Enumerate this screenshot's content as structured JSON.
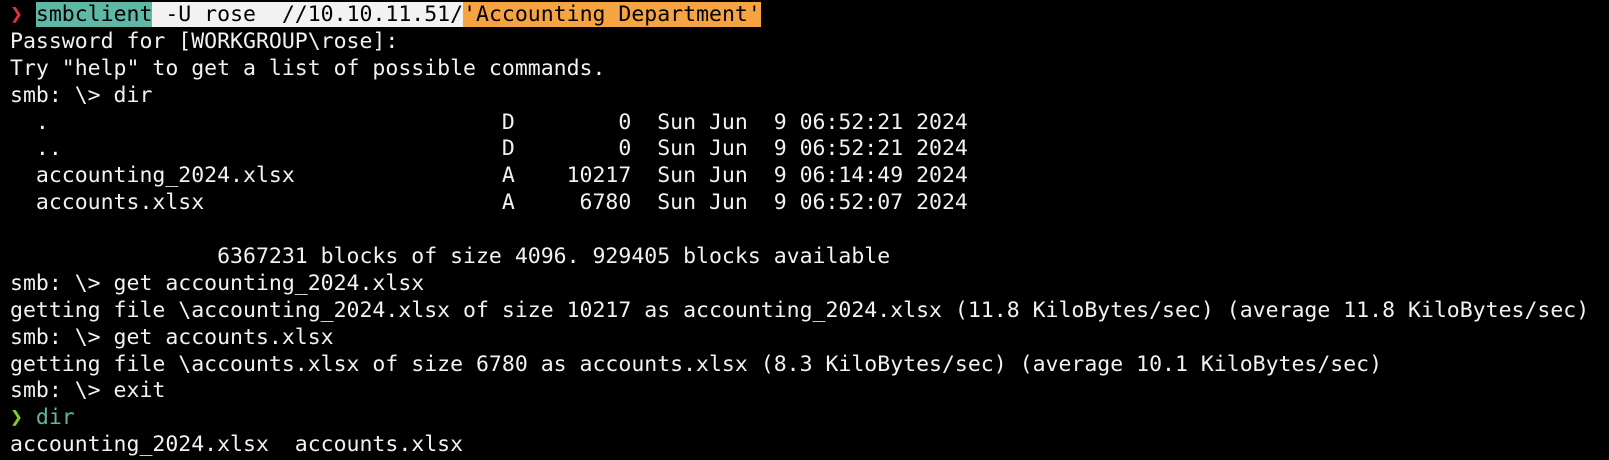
{
  "colors": {
    "background": "#000000",
    "foreground": "#f2f2f2",
    "prompt_error": "#e0323e",
    "prompt_ok": "#7ed321",
    "command_highlight": "#5fb8a6",
    "args_highlight": "#f2f2f2",
    "quoted_highlight": "#f6a341"
  },
  "prompt_glyph": "❯",
  "first_command": {
    "command": "smbclient",
    "args": " -U rose  //10.10.11.51/",
    "quoted": "'Accounting Department'"
  },
  "output_lines": [
    "Password for [WORKGROUP\\rose]:",
    "Try \"help\" to get a list of possible commands.",
    "smb: \\> dir",
    "  .                                   D        0  Sun Jun  9 06:52:21 2024",
    "  ..                                  D        0  Sun Jun  9 06:52:21 2024",
    "  accounting_2024.xlsx                A    10217  Sun Jun  9 06:14:49 2024",
    "  accounts.xlsx                       A     6780  Sun Jun  9 06:52:07 2024",
    "",
    "                6367231 blocks of size 4096. 929405 blocks available",
    "smb: \\> get accounting_2024.xlsx",
    "getting file \\accounting_2024.xlsx of size 10217 as accounting_2024.xlsx (11.8 KiloBytes/sec) (average 11.8 KiloBytes/sec)",
    "smb: \\> get accounts.xlsx",
    "getting file \\accounts.xlsx of size 6780 as accounts.xlsx (8.3 KiloBytes/sec) (average 10.1 KiloBytes/sec)",
    "smb: \\> exit"
  ],
  "second_command": {
    "command": "dir"
  },
  "final_output": "accounting_2024.xlsx  accounts.xlsx"
}
